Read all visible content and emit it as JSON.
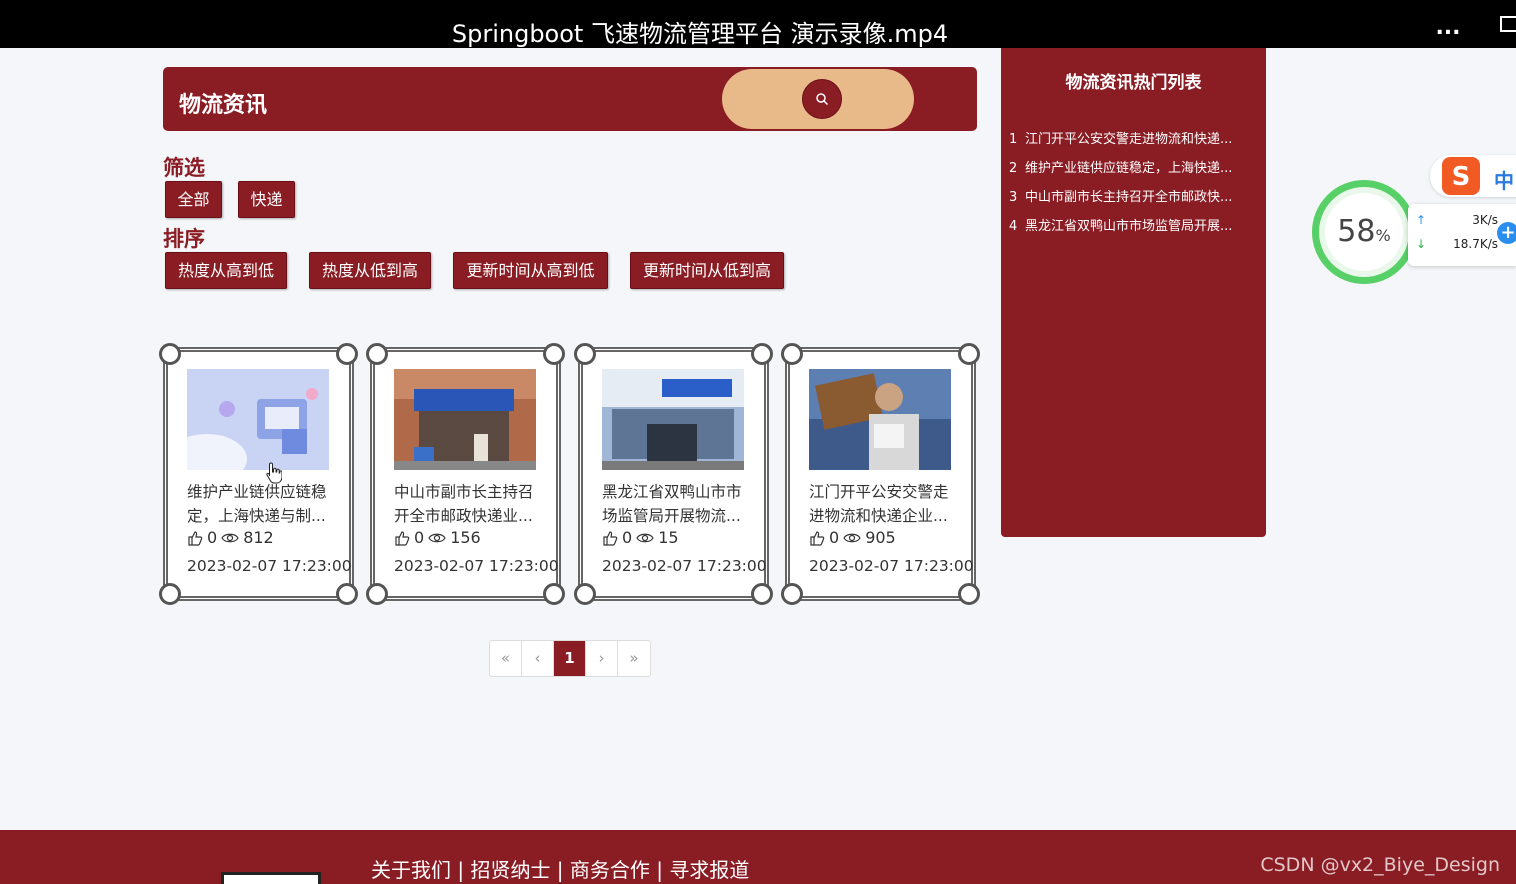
{
  "video": {
    "title": "Springboot 飞速物流管理平台 演示录像.mp4",
    "more_label": "..."
  },
  "header": {
    "title": "物流资讯"
  },
  "filter": {
    "label": "筛选",
    "buttons": [
      "全部",
      "快递"
    ]
  },
  "sort": {
    "label": "排序",
    "buttons": [
      "热度从高到低",
      "热度从低到高",
      "更新时间从高到低",
      "更新时间从低到高"
    ]
  },
  "cards": [
    {
      "title": "维护产业链供应链稳定，上海快递与制...",
      "likes": "0",
      "views": "812",
      "date": "2023-02-07 17:23:00"
    },
    {
      "title": "中山市副市长主持召开全市邮政快递业...",
      "likes": "0",
      "views": "156",
      "date": "2023-02-07 17:23:00"
    },
    {
      "title": "黑龙江省双鸭山市市场监管局开展物流...",
      "likes": "0",
      "views": "15",
      "date": "2023-02-07 17:23:00"
    },
    {
      "title": "江门开平公安交警走进物流和快递企业...",
      "likes": "0",
      "views": "905",
      "date": "2023-02-07 17:23:00"
    }
  ],
  "pagination": {
    "first": "«",
    "prev": "‹",
    "current": "1",
    "next": "›",
    "last": "»"
  },
  "hot_list": {
    "title": "物流资讯热门列表",
    "items": [
      {
        "num": "1",
        "text": "江门开平公安交警走进物流和快递..."
      },
      {
        "num": "2",
        "text": "维护产业链供应链稳定，上海快递..."
      },
      {
        "num": "3",
        "text": "中山市副市长主持召开全市邮政快..."
      },
      {
        "num": "4",
        "text": "黑龙江省双鸭山市市场监管局开展..."
      }
    ]
  },
  "widgets": {
    "speed_percent": "58",
    "speed_unit": "%",
    "upload": "3K/s",
    "download": "18.7K/s",
    "ime_lang": "中"
  },
  "footer": {
    "links": "关于我们 | 招贤纳士 | 商务合作 | 寻求报道",
    "watermark": "CSDN @vx2_Biye_Design"
  },
  "colors": {
    "brand": "#8a1c24",
    "search_pill": "#e8b989",
    "speed_ring": "#57d067"
  }
}
